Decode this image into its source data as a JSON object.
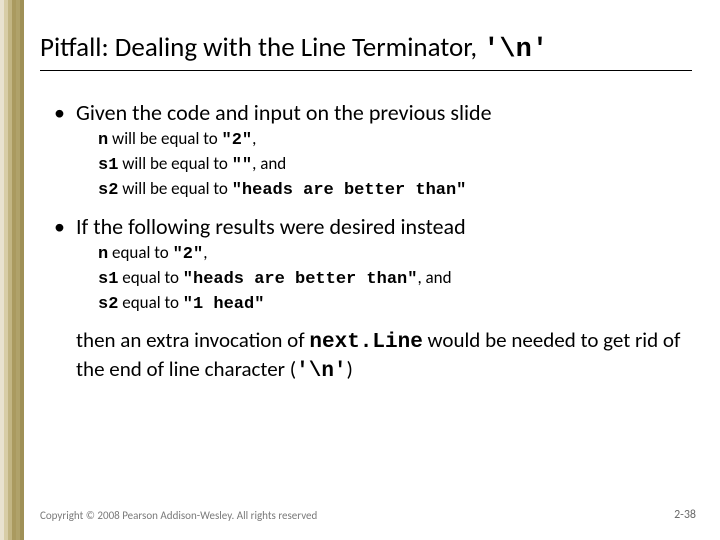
{
  "edge_colors": [
    "#e9e2cf",
    "#d8cda6",
    "#c2b583",
    "#aa9a5f",
    "#b0a26a",
    "#9f9057"
  ],
  "title": {
    "pre": "Pitfall:  Dealing with the Line Terminator, ",
    "code": "'\\n'"
  },
  "bullets": [
    {
      "text": "Given the code and input on the previous slide",
      "subs": [
        {
          "var": "n",
          "mid": " will be equal to ",
          "val": "\"2\"",
          "tail": ","
        },
        {
          "var": "s1",
          "mid": " will be equal to ",
          "val": "\"\"",
          "tail": ", and"
        },
        {
          "var": "s2",
          "mid": " will be equal to ",
          "val": "\"heads are better than\"",
          "tail": ""
        }
      ]
    },
    {
      "text": "If the following results were desired instead",
      "subs": [
        {
          "var": "n",
          "mid": " equal to ",
          "val": "\"2\"",
          "tail": ","
        },
        {
          "var": "s1",
          "mid": " equal to ",
          "val": "\"heads are better than\"",
          "tail": ", and"
        },
        {
          "var": "s2",
          "mid": " equal to ",
          "val": "\"1 head\"",
          "tail": ""
        }
      ],
      "body": {
        "pre": "then an extra invocation of ",
        "code1": "next.Line",
        "mid": " would be needed to get rid of the end of line character (",
        "code2": "'\\n'",
        "post": ")"
      }
    }
  ],
  "footer": "Copyright © 2008 Pearson Addison-Wesley. All rights reserved",
  "pagenum": "2-38"
}
